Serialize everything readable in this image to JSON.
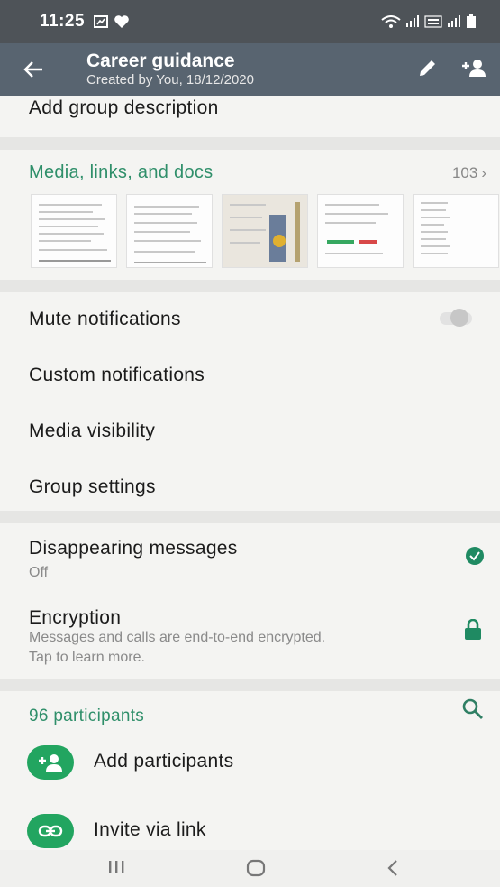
{
  "status_bar": {
    "time": "11:25"
  },
  "app_bar": {
    "title": "Career guidance",
    "subtitle": "Created by You, 18/12/2020"
  },
  "description": {
    "label": "Add group description"
  },
  "media": {
    "title": "Media, links, and docs",
    "count": "103",
    "thumbnail_count": 5
  },
  "settings": {
    "mute": "Mute notifications",
    "mute_enabled": false,
    "custom": "Custom notifications",
    "media_visibility": "Media visibility",
    "group_settings": "Group settings"
  },
  "disappearing": {
    "label": "Disappearing messages",
    "value": "Off"
  },
  "encryption": {
    "label": "Encryption",
    "line1": "Messages and calls are end-to-end encrypted.",
    "line2": "Tap to learn more."
  },
  "participants": {
    "count_label": "96 participants",
    "add": "Add participants",
    "invite": "Invite via link"
  },
  "colors": {
    "accent_green": "#2f8f6a",
    "button_green": "#22a560",
    "app_bar": "#586470"
  }
}
